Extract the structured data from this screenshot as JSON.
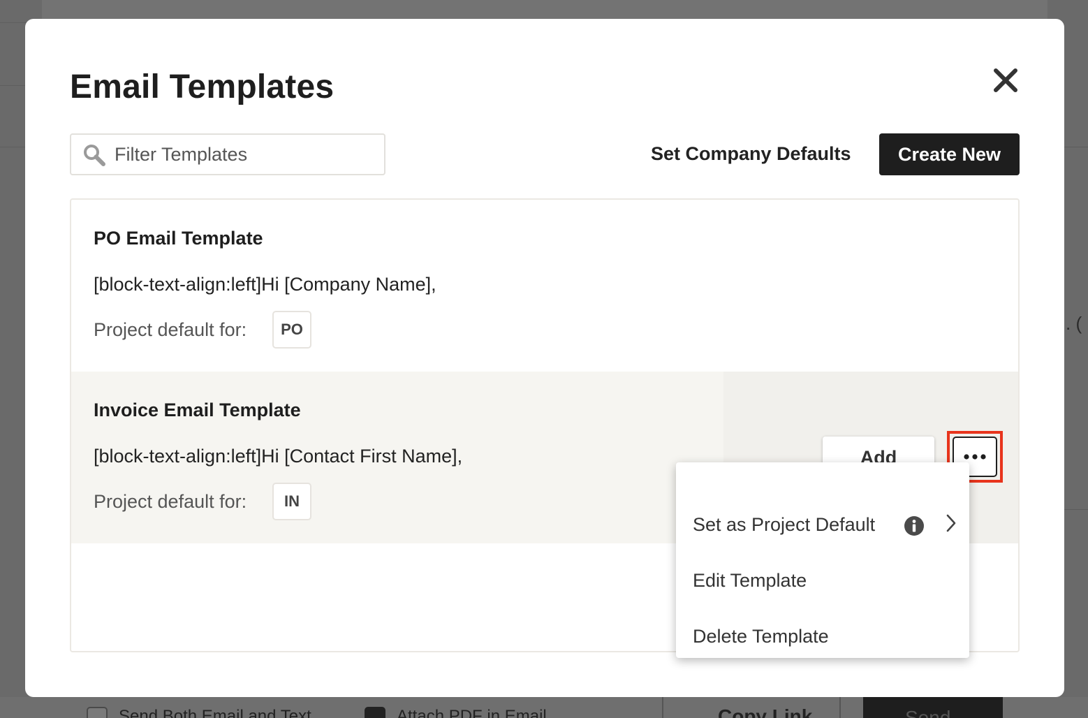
{
  "modal": {
    "title": "Email Templates",
    "close_icon": "close-icon"
  },
  "toolbar": {
    "search_placeholder": "Filter Templates",
    "search_value": "",
    "company_defaults_label": "Set Company Defaults",
    "create_label": "Create New"
  },
  "templates": [
    {
      "name": "PO Email Template",
      "body": "[block-text-align:left]Hi [Company Name],",
      "default_label": "Project default for:",
      "badge": "PO"
    },
    {
      "name": "Invoice Email Template",
      "body": "[block-text-align:left]Hi [Contact First Name],",
      "default_label": "Project default for:",
      "badge": "IN",
      "add_label": "Add"
    }
  ],
  "menu": {
    "items": [
      {
        "label": "Set as Project Default",
        "icons": [
          "info-icon",
          "chevron-right-icon"
        ]
      },
      {
        "label": "Edit Template"
      },
      {
        "label": "Delete Template"
      }
    ]
  },
  "background": {
    "send_both_label": "Send Both Email and Text",
    "attach_pdf_label": "Attach PDF in Email",
    "copy_link_label": "Copy Link",
    "send_label": "Send",
    "paren_text": ". ("
  },
  "colors": {
    "primary_button": "#1e1e1e",
    "highlight_row": "#f6f5f1",
    "focus_outline": "#e8341c"
  }
}
